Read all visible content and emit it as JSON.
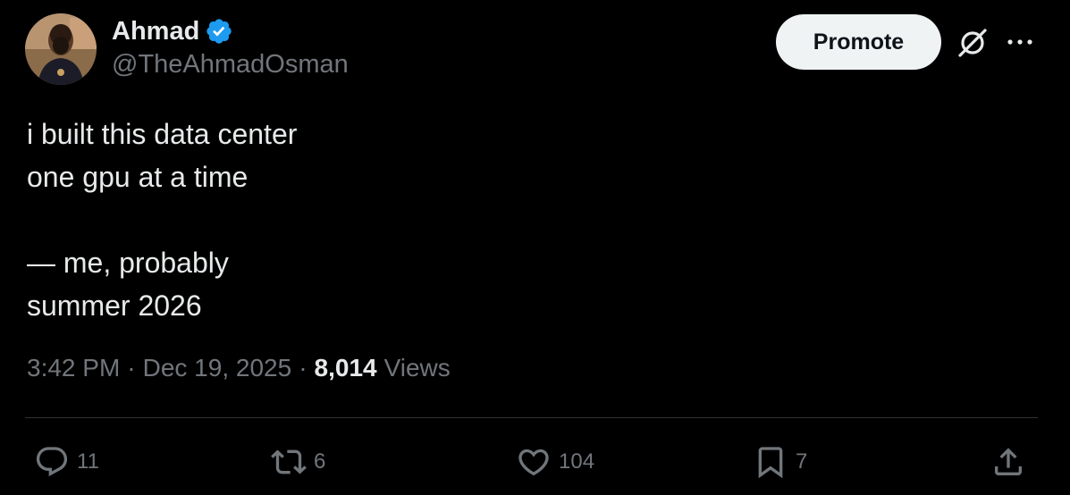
{
  "author": {
    "display_name": "Ahmad",
    "handle": "@TheAhmadOsman",
    "verified_icon": "verified-badge-icon"
  },
  "header": {
    "promote_label": "Promote",
    "grok_icon": "grok-icon",
    "more_icon": "more-horizontal-icon"
  },
  "tweet": {
    "lines": [
      "i built this data center",
      "one gpu at a time",
      "",
      "— me, probably",
      "summer 2026"
    ],
    "time": "3:42 PM",
    "date": "Dec 19, 2025",
    "views_count": "8,014",
    "views_label": "Views",
    "separator": "·"
  },
  "actions": {
    "replies": "11",
    "reposts": "6",
    "likes": "104",
    "bookmarks": "7"
  },
  "colors": {
    "background": "#000000",
    "primary_text": "#e7e9ea",
    "secondary_text": "#71767b",
    "verified_blue": "#1d9bf0",
    "promote_bg": "#eff3f4"
  }
}
